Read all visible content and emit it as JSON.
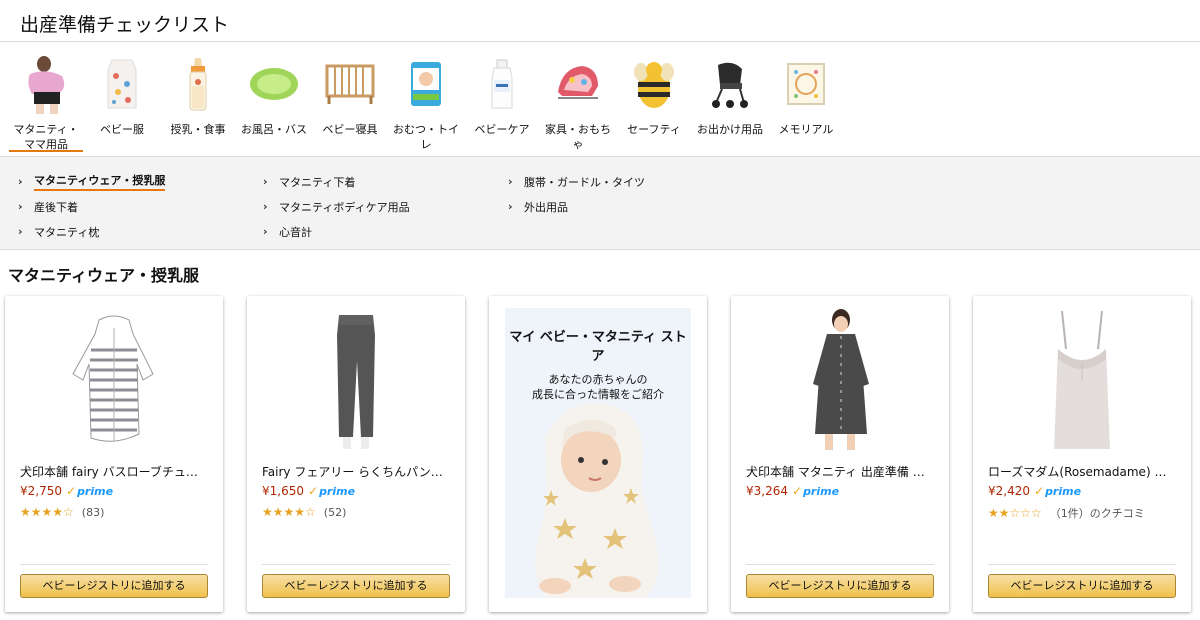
{
  "page": {
    "title": "出産準備チェックリスト"
  },
  "categories": [
    {
      "label": "マタニティ・ママ用品",
      "icon": "maternity-icon"
    },
    {
      "label": "ベビー服",
      "icon": "baby-clothes-icon"
    },
    {
      "label": "授乳・食事",
      "icon": "feeding-bottle-icon"
    },
    {
      "label": "お風呂・バス",
      "icon": "baby-bath-icon"
    },
    {
      "label": "ベビー寝具",
      "icon": "crib-icon"
    },
    {
      "label": "おむつ・トイレ",
      "icon": "diapers-icon"
    },
    {
      "label": "ベビーケア",
      "icon": "lotion-icon"
    },
    {
      "label": "家具・おもちゃ",
      "icon": "bouncer-icon"
    },
    {
      "label": "セーフティ",
      "icon": "bee-cushion-icon"
    },
    {
      "label": "お出かけ用品",
      "icon": "stroller-icon"
    },
    {
      "label": "メモリアル",
      "icon": "memorial-frame-icon"
    }
  ],
  "subnav": {
    "col1": [
      "マタニティウェア・授乳服",
      "産後下着",
      "マタニティ枕"
    ],
    "col2": [
      "マタニティ下着",
      "マタニティボディケア用品",
      "心音計"
    ],
    "col3": [
      "腹帯・ガードル・タイツ",
      "外出用品"
    ]
  },
  "section": {
    "title": "マタニティウェア・授乳服"
  },
  "products": [
    {
      "title": "犬印本舗 fairy バスローブチュ…",
      "price": "¥2,750",
      "prime": "prime",
      "stars": "★★★★☆",
      "reviews": "(83)",
      "button": "ベビーレジストリに追加する",
      "image": "bathrobe-image"
    },
    {
      "title": "Fairy フェアリー らくちんパン…",
      "price": "¥1,650",
      "prime": "prime",
      "stars": "★★★★☆",
      "reviews": "(52)",
      "button": "ベビーレジストリに追加する",
      "image": "pants-image"
    },
    {
      "title": "犬印本舗 マタニティ 出産準備 …",
      "price": "¥3,264",
      "prime": "prime",
      "stars": "",
      "reviews": "",
      "button": "ベビーレジストリに追加する",
      "image": "dress-image"
    },
    {
      "title": "ローズマダム(Rosemadame) …",
      "price": "¥2,420",
      "prime": "prime",
      "stars": "★★☆☆☆",
      "reviews": "（1件）のクチコミ",
      "button": "ベビーレジストリに追加する",
      "image": "camisole-image"
    }
  ],
  "promo": {
    "heading": "マイ ベビー・マタニティ ストア",
    "line1": "あなたの赤ちゃんの",
    "line2": "成長に合った情報をご紹介"
  },
  "colors": {
    "accent": "#e47911",
    "price": "#b12704",
    "prime": "#1a98ff",
    "star": "#e7a221",
    "button": "#f0c14b"
  }
}
